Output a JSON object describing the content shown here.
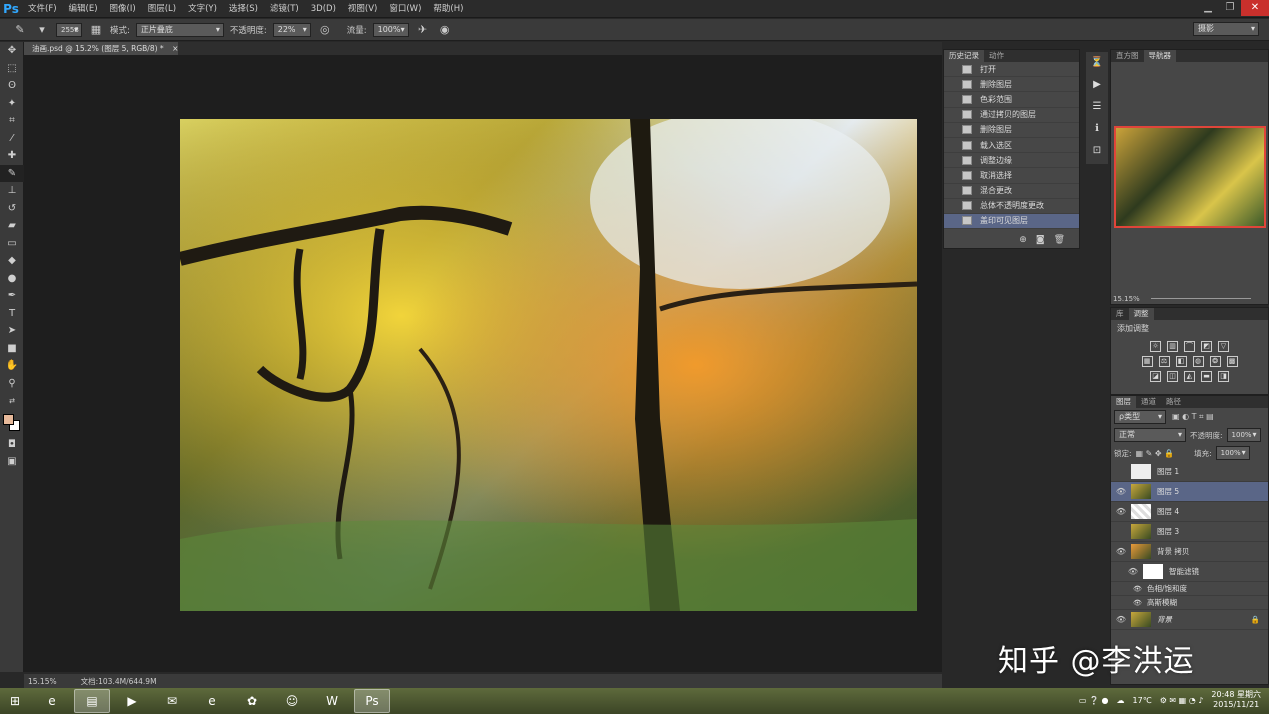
{
  "app": {
    "logo": "Ps"
  },
  "menu": [
    "文件(F)",
    "编辑(E)",
    "图像(I)",
    "图层(L)",
    "文字(Y)",
    "选择(S)",
    "滤镜(T)",
    "3D(D)",
    "视图(V)",
    "窗口(W)",
    "帮助(H)"
  ],
  "options": {
    "brush_size": "2558",
    "mode_label": "模式:",
    "mode_value": "正片叠底",
    "opacity_label": "不透明度:",
    "opacity_value": "22%",
    "flow_label": "流量:",
    "flow_value": "100%",
    "workspace": "摄影"
  },
  "document": {
    "tab": "油画.psd @ 15.2% (图层 5, RGB/8) *",
    "close": "×"
  },
  "history": {
    "tabs": [
      "历史记录",
      "动作"
    ],
    "items": [
      "打开",
      "删除图层",
      "色彩范围",
      "通过拷贝的图层",
      "删除图层",
      "载入选区",
      "调整边缘",
      "取消选择",
      "混合更改",
      "总体不透明度更改",
      "盖印可见图层"
    ]
  },
  "navigator": {
    "tabs": [
      "直方图",
      "导航器"
    ],
    "zoom": "15.15%"
  },
  "adjustments": {
    "tabs": [
      "库",
      "调整"
    ],
    "title": "添加调整"
  },
  "layers": {
    "tabs": [
      "图层",
      "通道",
      "路径"
    ],
    "filter": "ρ类型",
    "blend": "正常",
    "opacity_label": "不透明度:",
    "opacity_value": "100%",
    "lock_label": "锁定:",
    "fill_label": "填充:",
    "fill_value": "100%",
    "items": [
      {
        "name": "图层 1",
        "visible": false
      },
      {
        "name": "图层 5",
        "visible": true
      },
      {
        "name": "图层 4",
        "visible": true
      },
      {
        "name": "图层 3",
        "visible": false
      },
      {
        "name": "背景 拷贝",
        "visible": true
      },
      {
        "name": "智能滤镜",
        "visible": true
      },
      {
        "name": "色相/饱和度",
        "visible": true
      },
      {
        "name": "高斯模糊",
        "visible": true
      },
      {
        "name": "背景",
        "visible": true
      }
    ]
  },
  "status": {
    "zoom": "15.15%",
    "doc": "文档:103.4M/644.9M"
  },
  "taskbar": {
    "weather": "17℃",
    "time": "20:48 星期六",
    "date": "2015/11/21"
  },
  "watermark": "知乎 @李洪运"
}
